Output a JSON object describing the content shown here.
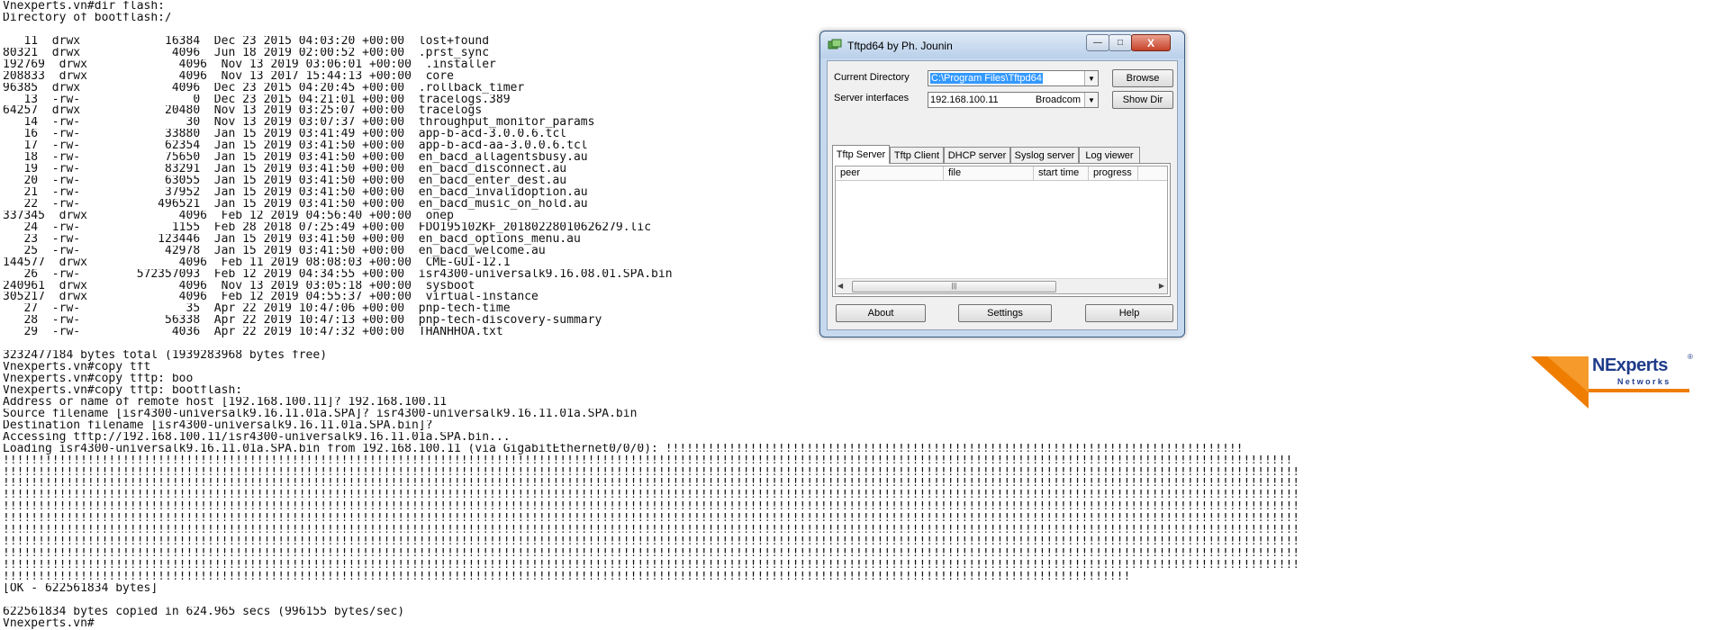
{
  "terminal": {
    "lines": [
      "Vnexperts.vn#dir flash:",
      "Directory of bootflash:/",
      "",
      "   11  drwx            16384  Dec 23 2015 04:03:20 +00:00  lost+found",
      "80321  drwx             4096  Jun 18 2019 02:00:52 +00:00  .prst_sync",
      "192769  drwx             4096  Nov 13 2019 03:06:01 +00:00  .installer",
      "208833  drwx             4096  Nov 13 2017 15:44:13 +00:00  core",
      "96385  drwx             4096  Dec 23 2015 04:20:45 +00:00  .rollback_timer",
      "   13  -rw-                0  Dec 23 2015 04:21:01 +00:00  tracelogs.389",
      "64257  drwx            20480  Nov 13 2019 03:25:07 +00:00  tracelogs",
      "   14  -rw-               30  Nov 13 2019 03:07:37 +00:00  throughput_monitor_params",
      "   16  -rw-            33880  Jan 15 2019 03:41:49 +00:00  app-b-acd-3.0.0.6.tcl",
      "   17  -rw-            62354  Jan 15 2019 03:41:50 +00:00  app-b-acd-aa-3.0.0.6.tcl",
      "   18  -rw-            75650  Jan 15 2019 03:41:50 +00:00  en_bacd_allagentsbusy.au",
      "   19  -rw-            83291  Jan 15 2019 03:41:50 +00:00  en_bacd_disconnect.au",
      "   20  -rw-            63055  Jan 15 2019 03:41:50 +00:00  en_bacd_enter_dest.au",
      "   21  -rw-            37952  Jan 15 2019 03:41:50 +00:00  en_bacd_invalidoption.au",
      "   22  -rw-           496521  Jan 15 2019 03:41:50 +00:00  en_bacd_music_on_hold.au",
      "337345  drwx             4096  Feb 12 2019 04:56:40 +00:00  onep",
      "   24  -rw-             1155  Feb 28 2018 07:25:49 +00:00  FDO195102KF_20180228010626279.lic",
      "   23  -rw-           123446  Jan 15 2019 03:41:50 +00:00  en_bacd_options_menu.au",
      "   25  -rw-            42978  Jan 15 2019 03:41:50 +00:00  en_bacd_welcome.au",
      "144577  drwx             4096  Feb 11 2019 08:08:03 +00:00  CME-GUI-12.1",
      "   26  -rw-        572357093  Feb 12 2019 04:34:55 +00:00  isr4300-universalk9.16.08.01.SPA.bin",
      "240961  drwx             4096  Nov 13 2019 03:05:18 +00:00  sysboot",
      "305217  drwx             4096  Feb 12 2019 04:55:37 +00:00  virtual-instance",
      "   27  -rw-               35  Apr 22 2019 10:47:06 +00:00  pnp-tech-time",
      "   28  -rw-            56338  Apr 22 2019 10:47:13 +00:00  pnp-tech-discovery-summary",
      "   29  -rw-             4036  Apr 22 2019 10:47:32 +00:00  THANHHOA.txt",
      "",
      "3232477184 bytes total (1939283968 bytes free)",
      "Vnexperts.vn#copy tft",
      "Vnexperts.vn#copy tftp: boo",
      "Vnexperts.vn#copy tftp: bootflash:",
      "Address or name of remote host [192.168.100.11]? 192.168.100.11",
      "Source filename [isr4300-universalk9.16.11.01a.SPA]? isr4300-universalk9.16.11.01a.SPA.bin",
      "Destination filename [isr4300-universalk9.16.11.01a.SPA.bin]?",
      "Accessing tftp://192.168.100.11/isr4300-universalk9.16.11.01a.SPA.bin...",
      "Loading isr4300-universalk9.16.11.01a.SPA.bin from 192.168.100.11 (via GigabitEthernet0/0/0): !!!!!!!!!!!!!!!!!!!!!!!!!!!!!!!!!!!!!!!!!!!!!!!!!!!!!!!!!!!!!!!!!!!!!!!!!!!!!!!!!!",
      "!!!!!!!!!!!!!!!!!!!!!!!!!!!!!!!!!!!!!!!!!!!!!!!!!!!!!!!!!!!!!!!!!!!!!!!!!!!!!!!!!!!!!!!!!!!!!!!!!!!!!!!!!!!!!!!!!!!!!!!!!!!!!!!!!!!!!!!!!!!!!!!!!!!!!!!!!!!!!!!!!!!!!!!!!!!!!!!!!!!!!!!",
      "!!!!!!!!!!!!!!!!!!!!!!!!!!!!!!!!!!!!!!!!!!!!!!!!!!!!!!!!!!!!!!!!!!!!!!!!!!!!!!!!!!!!!!!!!!!!!!!!!!!!!!!!!!!!!!!!!!!!!!!!!!!!!!!!!!!!!!!!!!!!!!!!!!!!!!!!!!!!!!!!!!!!!!!!!!!!!!!!!!!!!!!!",
      "!!!!!!!!!!!!!!!!!!!!!!!!!!!!!!!!!!!!!!!!!!!!!!!!!!!!!!!!!!!!!!!!!!!!!!!!!!!!!!!!!!!!!!!!!!!!!!!!!!!!!!!!!!!!!!!!!!!!!!!!!!!!!!!!!!!!!!!!!!!!!!!!!!!!!!!!!!!!!!!!!!!!!!!!!!!!!!!!!!!!!!!!",
      "!!!!!!!!!!!!!!!!!!!!!!!!!!!!!!!!!!!!!!!!!!!!!!!!!!!!!!!!!!!!!!!!!!!!!!!!!!!!!!!!!!!!!!!!!!!!!!!!!!!!!!!!!!!!!!!!!!!!!!!!!!!!!!!!!!!!!!!!!!!!!!!!!!!!!!!!!!!!!!!!!!!!!!!!!!!!!!!!!!!!!!!!",
      "!!!!!!!!!!!!!!!!!!!!!!!!!!!!!!!!!!!!!!!!!!!!!!!!!!!!!!!!!!!!!!!!!!!!!!!!!!!!!!!!!!!!!!!!!!!!!!!!!!!!!!!!!!!!!!!!!!!!!!!!!!!!!!!!!!!!!!!!!!!!!!!!!!!!!!!!!!!!!!!!!!!!!!!!!!!!!!!!!!!!!!!!",
      "!!!!!!!!!!!!!!!!!!!!!!!!!!!!!!!!!!!!!!!!!!!!!!!!!!!!!!!!!!!!!!!!!!!!!!!!!!!!!!!!!!!!!!!!!!!!!!!!!!!!!!!!!!!!!!!!!!!!!!!!!!!!!!!!!!!!!!!!!!!!!!!!!!!!!!!!!!!!!!!!!!!!!!!!!!!!!!!!!!!!!!!!",
      "!!!!!!!!!!!!!!!!!!!!!!!!!!!!!!!!!!!!!!!!!!!!!!!!!!!!!!!!!!!!!!!!!!!!!!!!!!!!!!!!!!!!!!!!!!!!!!!!!!!!!!!!!!!!!!!!!!!!!!!!!!!!!!!!!!!!!!!!!!!!!!!!!!!!!!!!!!!!!!!!!!!!!!!!!!!!!!!!!!!!!!!!",
      "!!!!!!!!!!!!!!!!!!!!!!!!!!!!!!!!!!!!!!!!!!!!!!!!!!!!!!!!!!!!!!!!!!!!!!!!!!!!!!!!!!!!!!!!!!!!!!!!!!!!!!!!!!!!!!!!!!!!!!!!!!!!!!!!!!!!!!!!!!!!!!!!!!!!!!!!!!!!!!!!!!!!!!!!!!!!!!!!!!!!!!!!",
      "!!!!!!!!!!!!!!!!!!!!!!!!!!!!!!!!!!!!!!!!!!!!!!!!!!!!!!!!!!!!!!!!!!!!!!!!!!!!!!!!!!!!!!!!!!!!!!!!!!!!!!!!!!!!!!!!!!!!!!!!!!!!!!!!!!!!!!!!!!!!!!!!!!!!!!!!!!!!!!!!!!!!!!!!!!!!!!!!!!!!!!!!",
      "!!!!!!!!!!!!!!!!!!!!!!!!!!!!!!!!!!!!!!!!!!!!!!!!!!!!!!!!!!!!!!!!!!!!!!!!!!!!!!!!!!!!!!!!!!!!!!!!!!!!!!!!!!!!!!!!!!!!!!!!!!!!!!!!!!!!!!!!!!!!!!!!!!!!!!!!!!!!!!!!!!!!!!!!!!!!!!!!!!!!!!!!",
      "!!!!!!!!!!!!!!!!!!!!!!!!!!!!!!!!!!!!!!!!!!!!!!!!!!!!!!!!!!!!!!!!!!!!!!!!!!!!!!!!!!!!!!!!!!!!!!!!!!!!!!!!!!!!!!!!!!!!!!!!!!!!!!!!!!!!!!!!!!!!!!!!!!!!!!!!!!!!!!!!",
      "[OK - 622561834 bytes]",
      "",
      "622561834 bytes copied in 624.965 secs (996155 bytes/sec)",
      "Vnexperts.vn#"
    ]
  },
  "tftp": {
    "title": "Tftpd64 by Ph. Jounin",
    "current_directory_label": "Current Directory",
    "current_directory_value": "C:\\Program Files\\Tftpd64",
    "server_interfaces_label": "Server interfaces",
    "server_ip": "192.168.100.11",
    "server_adapter": "Broadcom",
    "browse_label": "Browse",
    "show_dir_label": "Show Dir",
    "tabs": [
      "Tftp Server",
      "Tftp Client",
      "DHCP server",
      "Syslog server",
      "Log viewer"
    ],
    "active_tab": "Tftp Server",
    "columns": [
      "peer",
      "file",
      "start time",
      "progress"
    ],
    "scroll_thumb_grip": "|||",
    "about_label": "About",
    "settings_label": "Settings",
    "help_label": "Help",
    "close_glyph": "X",
    "minimize_glyph": "—",
    "maximize_glyph": "□"
  },
  "logo": {
    "text": "NExperts",
    "subtext": "Networks",
    "registered": "®",
    "brand_orange": "#ef7d00",
    "brand_blue": "#1f3b8a"
  }
}
